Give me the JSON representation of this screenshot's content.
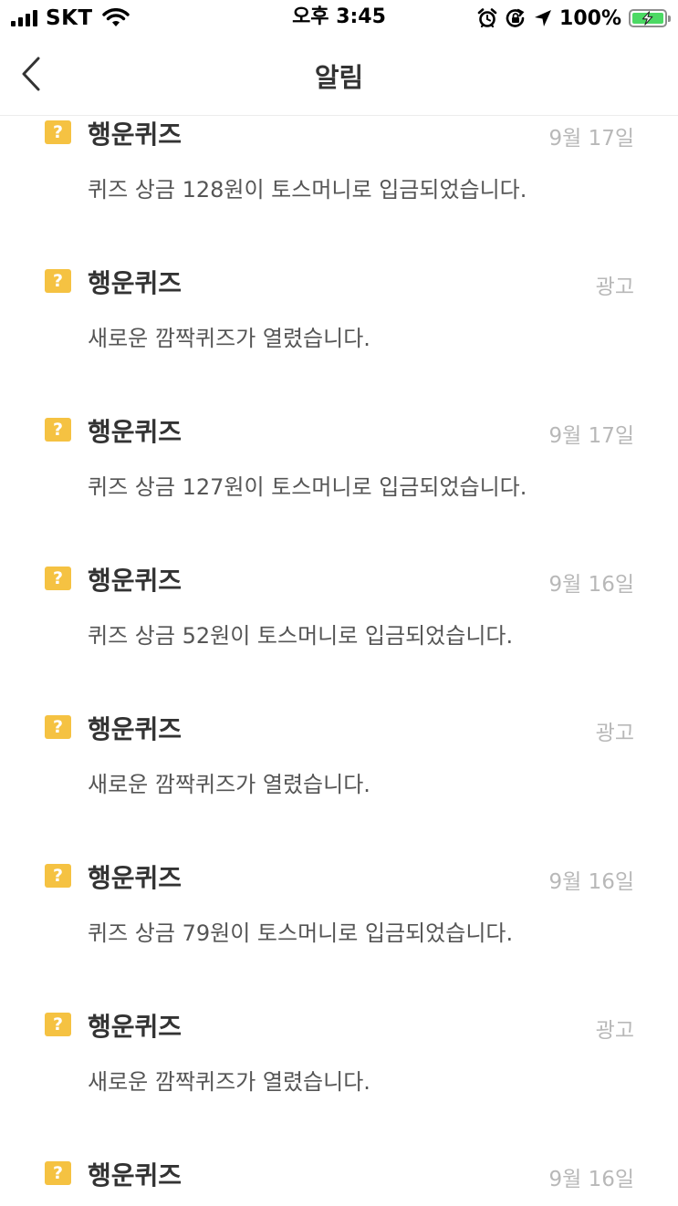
{
  "status_bar": {
    "carrier": "SKT",
    "time": "오후 3:45",
    "battery_percent": "100%",
    "icons": [
      "signal-icon",
      "wifi-icon",
      "alarm-icon",
      "orientation-lock-icon",
      "location-arrow-icon",
      "battery-charging-icon"
    ]
  },
  "nav": {
    "back_icon": "chevron-left-icon",
    "title": "알림"
  },
  "notifications": [
    {
      "badge": "?",
      "sender": "행운퀴즈",
      "meta": "9월 17일",
      "message": "퀴즈 상금 128원이 토스머니로 입금되었습니다."
    },
    {
      "badge": "?",
      "sender": "행운퀴즈",
      "meta": "광고",
      "message": "새로운 깜짝퀴즈가 열렸습니다."
    },
    {
      "badge": "?",
      "sender": "행운퀴즈",
      "meta": "9월 17일",
      "message": "퀴즈 상금 127원이 토스머니로 입금되었습니다."
    },
    {
      "badge": "?",
      "sender": "행운퀴즈",
      "meta": "9월 16일",
      "message": "퀴즈 상금 52원이 토스머니로 입금되었습니다."
    },
    {
      "badge": "?",
      "sender": "행운퀴즈",
      "meta": "광고",
      "message": "새로운 깜짝퀴즈가 열렸습니다."
    },
    {
      "badge": "?",
      "sender": "행운퀴즈",
      "meta": "9월 16일",
      "message": "퀴즈 상금 79원이 토스머니로 입금되었습니다."
    },
    {
      "badge": "?",
      "sender": "행운퀴즈",
      "meta": "광고",
      "message": "새로운 깜짝퀴즈가 열렸습니다."
    },
    {
      "badge": "?",
      "sender": "행운퀴즈",
      "meta": "9월 16일",
      "message": ""
    }
  ],
  "colors": {
    "badge": "#f5c242",
    "title_text": "#333333",
    "meta_text": "#b8b8b8",
    "message_text": "#555555",
    "battery_fill": "#4cd964"
  }
}
